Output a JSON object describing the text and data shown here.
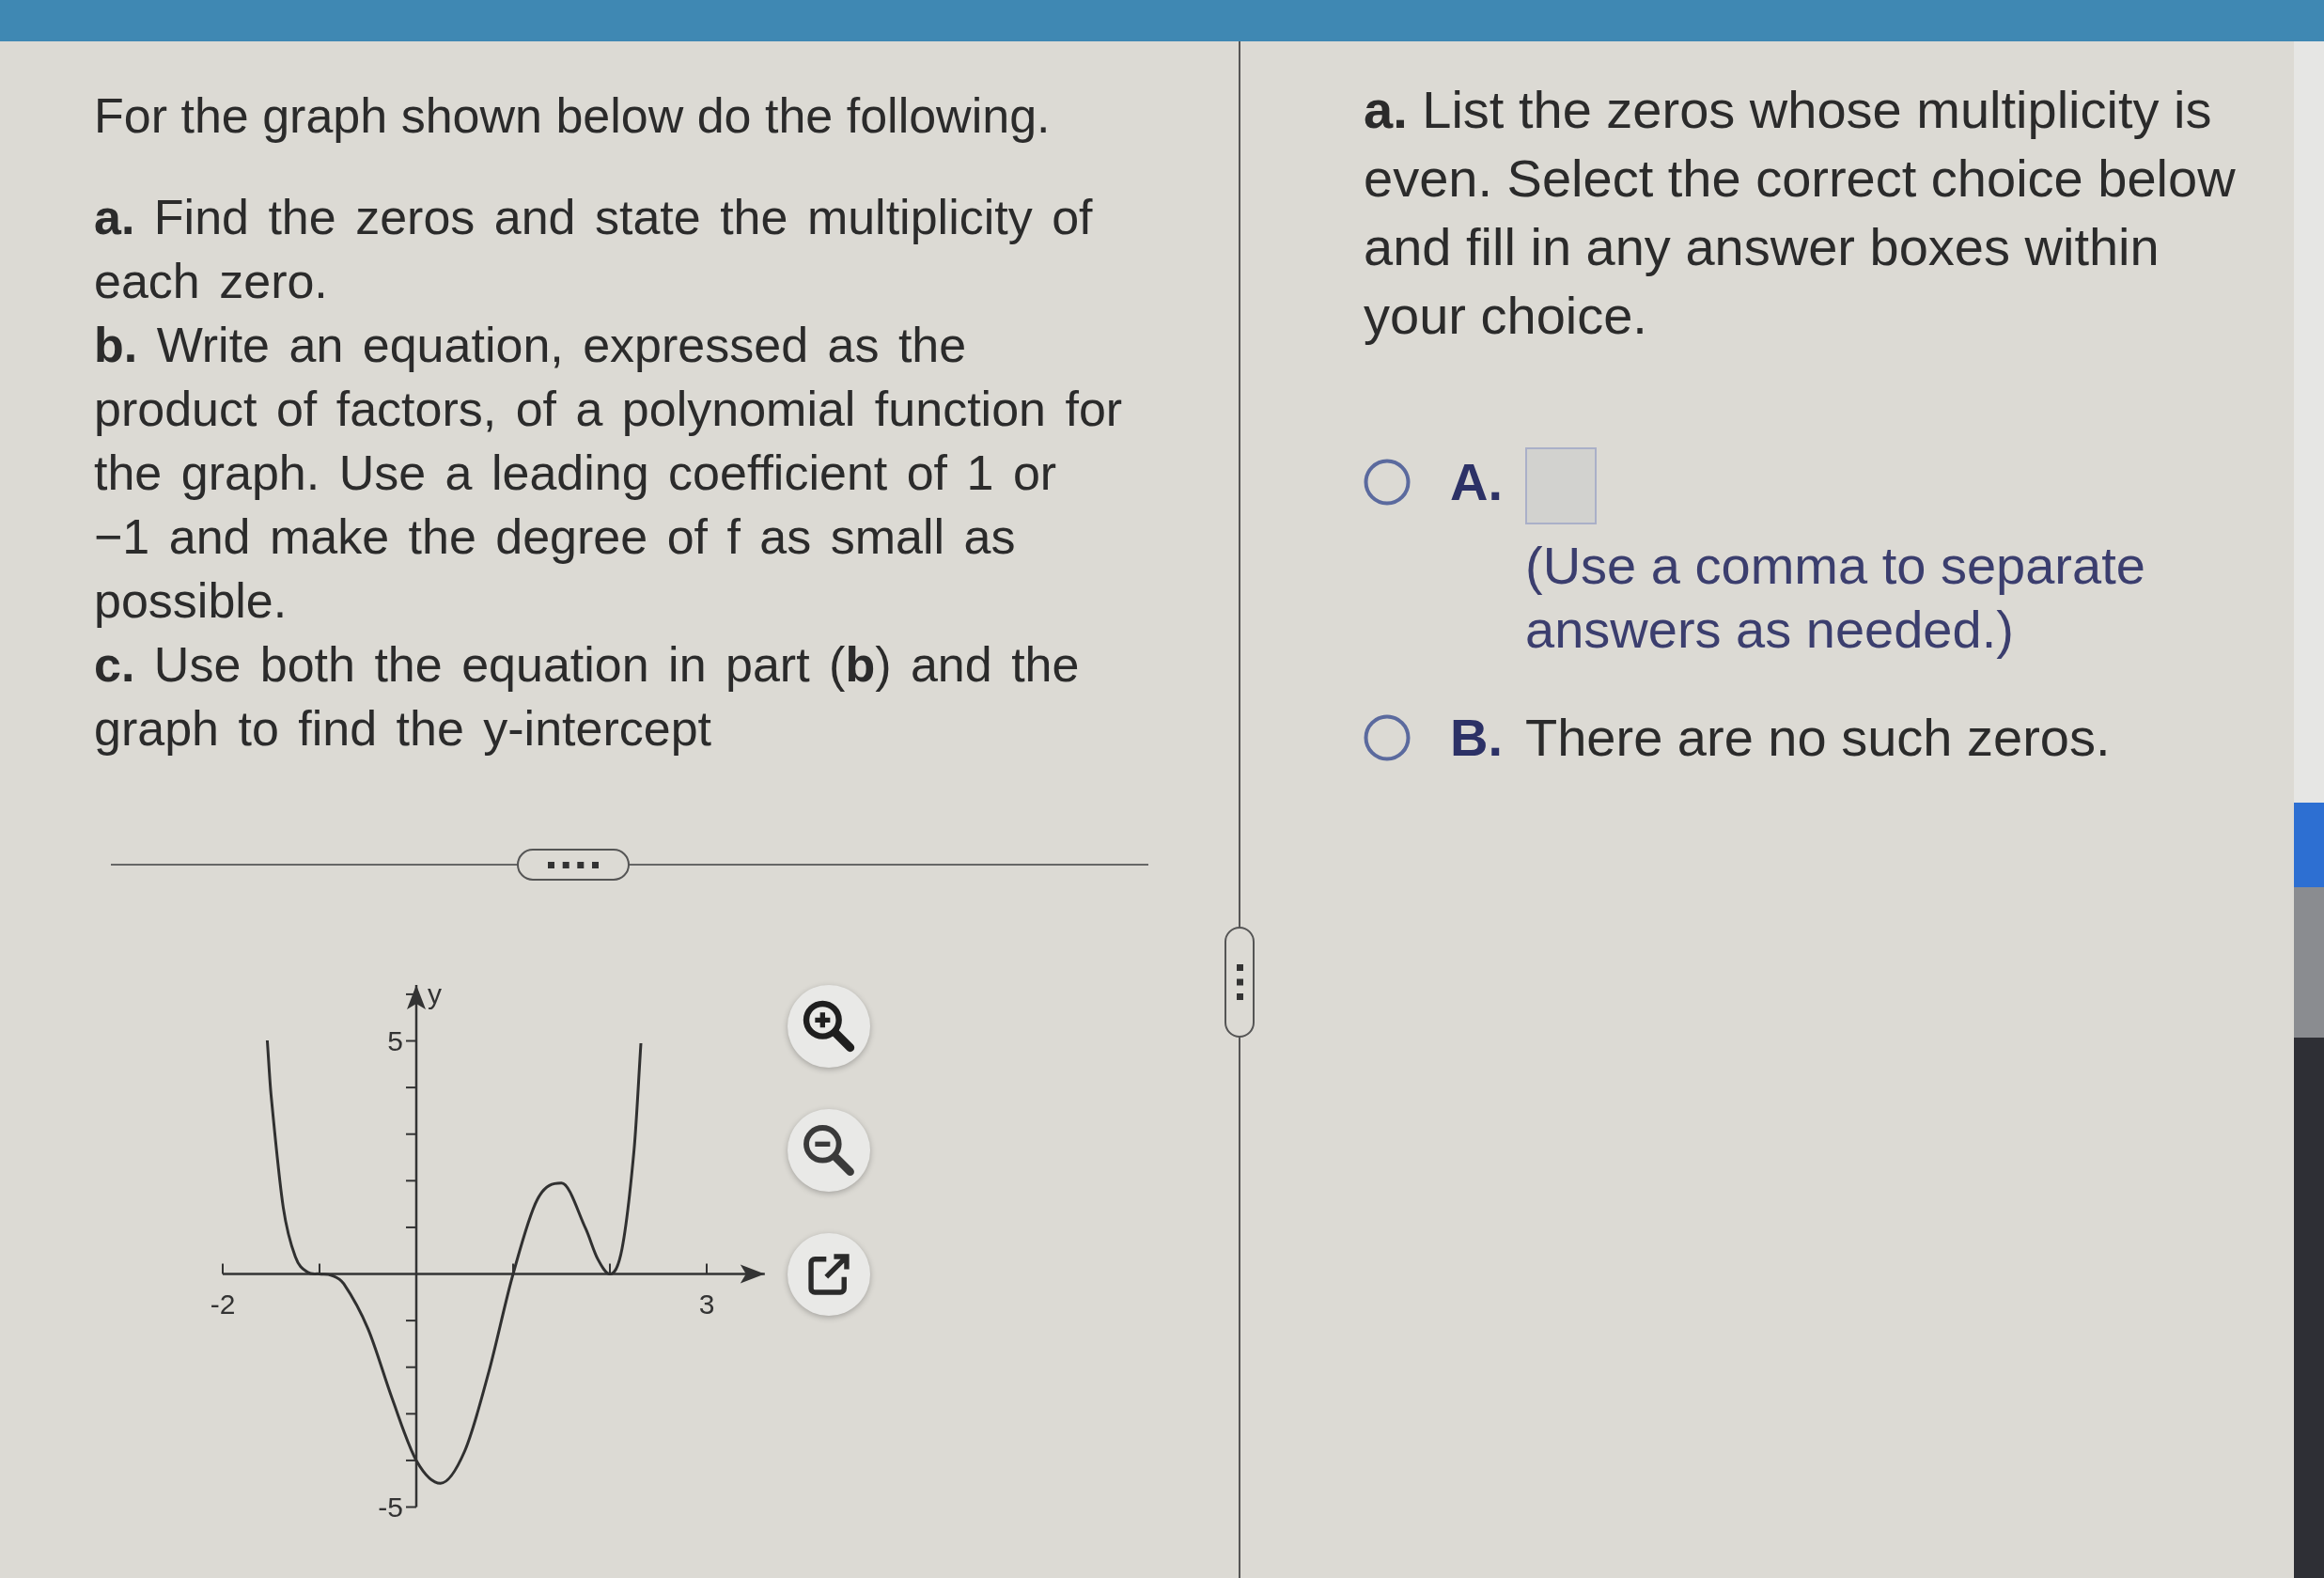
{
  "question": {
    "heading": "For the graph shown below do the following.",
    "parts": [
      "**a.** Find the zeros and state the multiplicity of each zero.",
      "**b.** Write an equation, expressed as the product of factors, of a polynomial function for the graph. Use a leading coefficient of 1 or −1 and make the degree of f as small as possible.",
      "**c.** Use both the equation in part (**b**) and the graph to find the y-intercept"
    ]
  },
  "graph": {
    "chart_data": {
      "type": "line",
      "ylabel": "y",
      "xlim": [
        -2,
        3.6
      ],
      "ylim": [
        -5,
        6.2
      ],
      "xticks": [
        -2,
        3
      ],
      "yticks": [
        -5,
        5
      ],
      "x": [
        -1.54,
        -1.5,
        -1.375,
        -1.25,
        -1.125,
        -1,
        -0.875,
        -0.75,
        -0.5,
        -0.25,
        0,
        0.25,
        0.5,
        0.75,
        1,
        1.25,
        1.5,
        1.75,
        1.875,
        2,
        2.125,
        2.25,
        2.32
      ],
      "values": [
        5.01,
        3.83,
        1.43,
        0.37,
        0.04,
        0,
        -0.03,
        -0.21,
        -1.17,
        -2.67,
        -4,
        -4.49,
        -3.8,
        -2.09,
        0,
        1.6,
        1.95,
        0.97,
        0.32,
        0,
        0.54,
        2.68,
        4.95
      ]
    }
  },
  "answer": {
    "prompt": "**a.** List the zeros whose multiplicity is even. Select the correct choice below and fill in any answer boxes within your choice.",
    "choices": [
      {
        "kind": "input",
        "letter": "A.",
        "selected": false,
        "hint": "(Use a comma to separate answers as needed.)"
      },
      {
        "kind": "statement",
        "letter": "B.",
        "selected": false,
        "text": "There are no such zeros."
      }
    ]
  }
}
